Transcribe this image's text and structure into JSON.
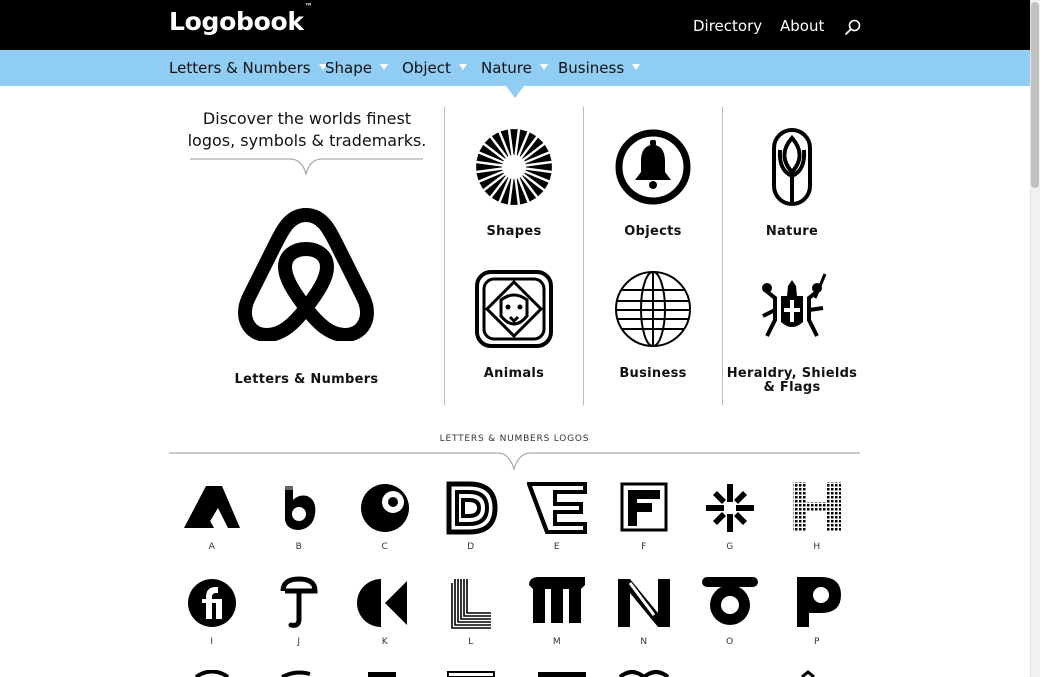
{
  "header": {
    "logo_text": "Logobook",
    "logo_tm": "™",
    "nav": {
      "directory": "Directory",
      "about": "About"
    },
    "search_icon": "search-icon"
  },
  "categories_nav": [
    "Letters & Numbers",
    "Shape",
    "Object",
    "Nature",
    "Business"
  ],
  "hero": {
    "tagline_line1": "Discover the worlds finest",
    "tagline_line2": "logos, symbols & trademarks.",
    "featured_label": "Letters & Numbers"
  },
  "category_cards": [
    {
      "label": "Shapes",
      "icon": "radial-burst-icon"
    },
    {
      "label": "Objects",
      "icon": "bell-icon"
    },
    {
      "label": "Nature",
      "icon": "tulip-icon"
    },
    {
      "label": "Animals",
      "icon": "lion-icon"
    },
    {
      "label": "Business",
      "icon": "globe-icon"
    },
    {
      "label": "Heraldry, Shields & Flags",
      "icon": "coat-of-arms-icon"
    }
  ],
  "section": {
    "title": "LETTERS & NUMBERS LOGOS"
  },
  "letters": [
    "A",
    "B",
    "C",
    "D",
    "E",
    "F",
    "G",
    "H",
    "I",
    "J",
    "K",
    "L",
    "M",
    "N",
    "O",
    "P"
  ],
  "colors": {
    "topbar": "#000000",
    "catbar": "#8fcdf5",
    "text": "#111111"
  }
}
